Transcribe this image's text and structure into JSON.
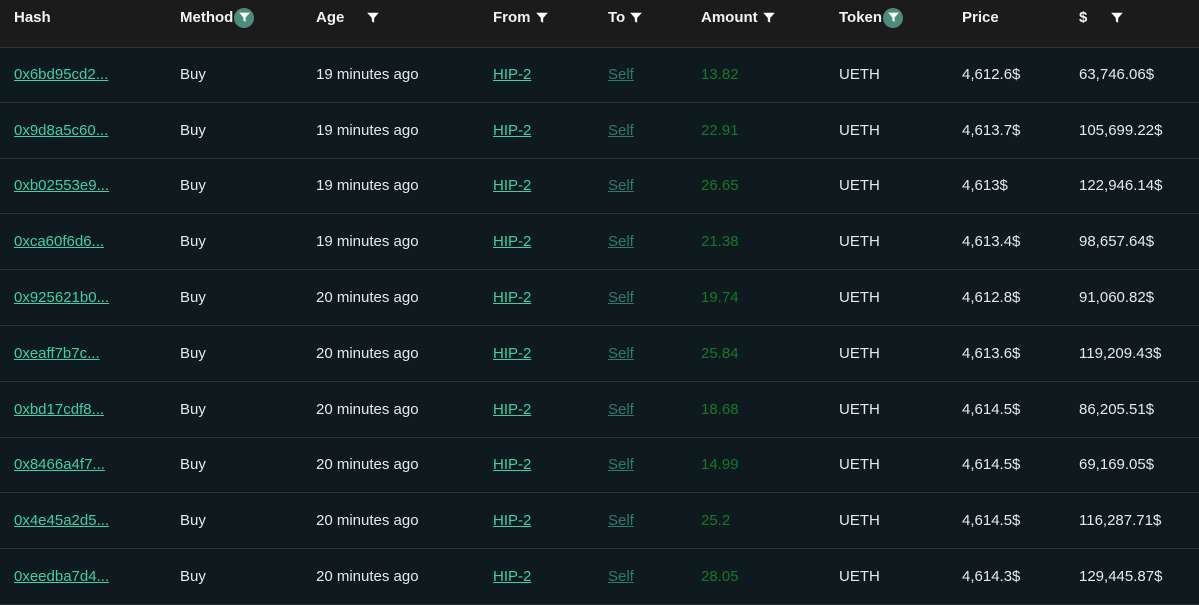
{
  "colors": {
    "accent": "#38d0ad",
    "muted_link": "#2e7b6c",
    "amount": "#117a2a",
    "active_filter": "#4c8c7a"
  },
  "headers": {
    "hash": "Hash",
    "method": "Method",
    "age": "Age",
    "from": "From",
    "to": "To",
    "amount": "Amount",
    "token": "Token",
    "price": "Price",
    "usd": "$"
  },
  "filter_icons": [
    "filter-icon"
  ],
  "rows": [
    {
      "hash": "0x6bd95cd2...",
      "method": "Buy",
      "age": "19 minutes ago",
      "from": "HIP-2",
      "to": "Self",
      "amount": "13.82",
      "token": "UETH",
      "price": "4,612.6$",
      "usd": "63,746.06$"
    },
    {
      "hash": "0x9d8a5c60...",
      "method": "Buy",
      "age": "19 minutes ago",
      "from": "HIP-2",
      "to": "Self",
      "amount": "22.91",
      "token": "UETH",
      "price": "4,613.7$",
      "usd": "105,699.22$"
    },
    {
      "hash": "0xb02553e9...",
      "method": "Buy",
      "age": "19 minutes ago",
      "from": "HIP-2",
      "to": "Self",
      "amount": "26.65",
      "token": "UETH",
      "price": "4,613$",
      "usd": "122,946.14$"
    },
    {
      "hash": "0xca60f6d6...",
      "method": "Buy",
      "age": "19 minutes ago",
      "from": "HIP-2",
      "to": "Self",
      "amount": "21.38",
      "token": "UETH",
      "price": "4,613.4$",
      "usd": "98,657.64$"
    },
    {
      "hash": "0x925621b0...",
      "method": "Buy",
      "age": "20 minutes ago",
      "from": "HIP-2",
      "to": "Self",
      "amount": "19.74",
      "token": "UETH",
      "price": "4,612.8$",
      "usd": "91,060.82$"
    },
    {
      "hash": "0xeaff7b7c...",
      "method": "Buy",
      "age": "20 minutes ago",
      "from": "HIP-2",
      "to": "Self",
      "amount": "25.84",
      "token": "UETH",
      "price": "4,613.6$",
      "usd": "119,209.43$"
    },
    {
      "hash": "0xbd17cdf8...",
      "method": "Buy",
      "age": "20 minutes ago",
      "from": "HIP-2",
      "to": "Self",
      "amount": "18.68",
      "token": "UETH",
      "price": "4,614.5$",
      "usd": "86,205.51$"
    },
    {
      "hash": "0x8466a4f7...",
      "method": "Buy",
      "age": "20 minutes ago",
      "from": "HIP-2",
      "to": "Self",
      "amount": "14.99",
      "token": "UETH",
      "price": "4,614.5$",
      "usd": "69,169.05$"
    },
    {
      "hash": "0x4e45a2d5...",
      "method": "Buy",
      "age": "20 minutes ago",
      "from": "HIP-2",
      "to": "Self",
      "amount": "25.2",
      "token": "UETH",
      "price": "4,614.5$",
      "usd": "116,287.71$"
    },
    {
      "hash": "0xeedba7d4...",
      "method": "Buy",
      "age": "20 minutes ago",
      "from": "HIP-2",
      "to": "Self",
      "amount": "28.05",
      "token": "UETH",
      "price": "4,614.3$",
      "usd": "129,445.87$"
    }
  ]
}
